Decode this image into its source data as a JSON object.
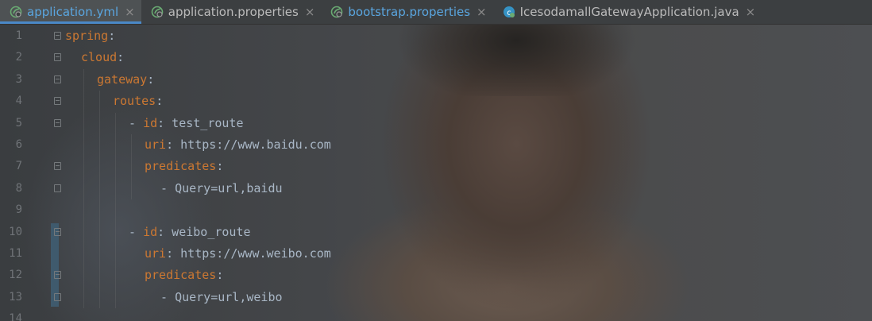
{
  "tabs": [
    {
      "label": "application.yml",
      "active": true,
      "icon": "spring-yml-icon"
    },
    {
      "label": "application.properties",
      "active": false,
      "icon": "spring-properties-icon"
    },
    {
      "label": "bootstrap.properties",
      "active": false,
      "icon": "spring-properties-icon"
    },
    {
      "label": "IcesodamallGatewayApplication.java",
      "active": false,
      "icon": "java-class-icon"
    }
  ],
  "close_glyph": "×",
  "lines": [
    {
      "n": "1",
      "indent": 0,
      "key": "spring",
      "sep": ":",
      "value": ""
    },
    {
      "n": "2",
      "indent": 2,
      "key": "cloud",
      "sep": ":",
      "value": ""
    },
    {
      "n": "3",
      "indent": 4,
      "key": "gateway",
      "sep": ":",
      "value": ""
    },
    {
      "n": "4",
      "indent": 6,
      "key": "routes",
      "sep": ":",
      "value": ""
    },
    {
      "n": "5",
      "indent": 8,
      "prefix": "- ",
      "key": "id",
      "sep": ":",
      "value": " test_route"
    },
    {
      "n": "6",
      "indent": 10,
      "key": "uri",
      "sep": ":",
      "value": " https://www.baidu.com"
    },
    {
      "n": "7",
      "indent": 10,
      "key": "predicates",
      "sep": ":",
      "value": ""
    },
    {
      "n": "8",
      "indent": 12,
      "prefix": "- ",
      "key": "",
      "sep": "",
      "value": "Query=url,baidu"
    },
    {
      "n": "9",
      "indent": 0,
      "key": "",
      "sep": "",
      "value": ""
    },
    {
      "n": "10",
      "indent": 8,
      "prefix": "- ",
      "key": "id",
      "sep": ":",
      "value": " weibo_route"
    },
    {
      "n": "11",
      "indent": 10,
      "key": "uri",
      "sep": ":",
      "value": " https://www.weibo.com"
    },
    {
      "n": "12",
      "indent": 10,
      "key": "predicates",
      "sep": ":",
      "value": ""
    },
    {
      "n": "13",
      "indent": 12,
      "prefix": "- ",
      "key": "",
      "sep": "",
      "value": "Query=url,weibo"
    },
    {
      "n": "14",
      "indent": 0,
      "key": "",
      "sep": "",
      "value": ""
    }
  ],
  "colors": {
    "key": "#cc7832",
    "text": "#a9b7c6",
    "active_tab_text": "#5aa6e0",
    "line_number": "#6f7377"
  }
}
